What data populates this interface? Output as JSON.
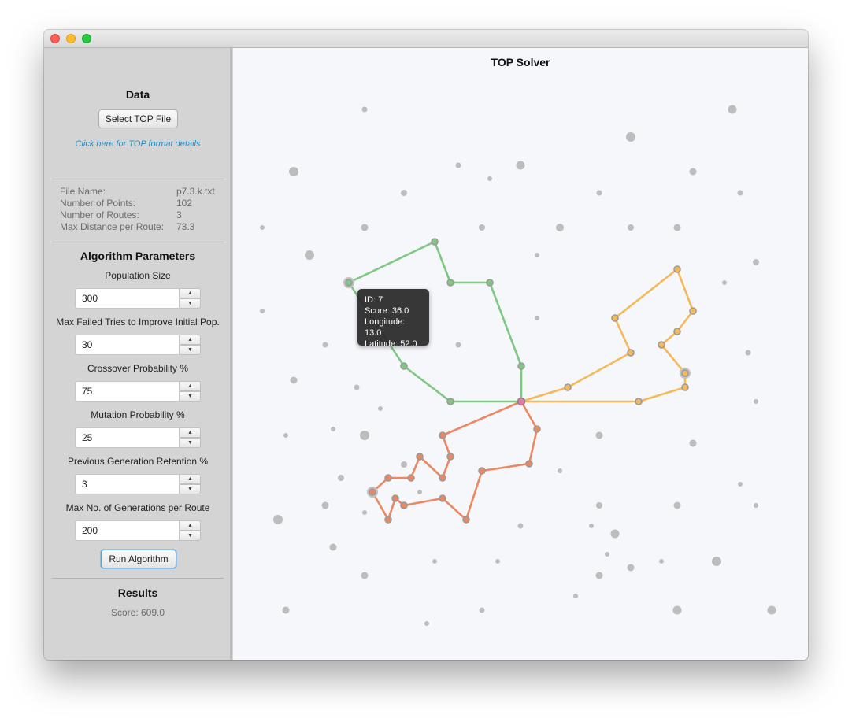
{
  "window": {
    "title": ""
  },
  "sidebar": {
    "data_title": "Data",
    "select_file_label": "Select TOP File",
    "format_link": "Click here for TOP format details",
    "info": [
      {
        "key": "File Name:",
        "value": "p7.3.k.txt"
      },
      {
        "key": "Number of Points:",
        "value": "102"
      },
      {
        "key": "Number of Routes:",
        "value": "3"
      },
      {
        "key": "Max Distance per Route:",
        "value": "73.3"
      }
    ],
    "params_title": "Algorithm Parameters",
    "params": [
      {
        "label": "Population Size",
        "value": "300"
      },
      {
        "label": "Max Failed Tries to Improve Initial Pop.",
        "value": "30"
      },
      {
        "label": "Crossover Probability %",
        "value": "75"
      },
      {
        "label": "Mutation Probability %",
        "value": "25"
      },
      {
        "label": "Previous Generation Retention %",
        "value": "3"
      },
      {
        "label": "Max No. of Generations per Route",
        "value": "200"
      }
    ],
    "run_label": "Run Algorithm",
    "results_title": "Results",
    "score_label": "Score:",
    "score_value": "609.0"
  },
  "map": {
    "title": "TOP Solver",
    "colors": {
      "background": "#f6f7fb",
      "point": "#bdbdbd",
      "green_route": "#7ec882",
      "orange_route": "#f5b95a",
      "red_route": "#ec8762",
      "depot": "#e57aa8"
    },
    "tooltip": {
      "id": "ID: 7",
      "score": "Score: 36.0",
      "longitude": "Longitude: 13.0",
      "latitude": "Latitude: 52.0"
    }
  }
}
